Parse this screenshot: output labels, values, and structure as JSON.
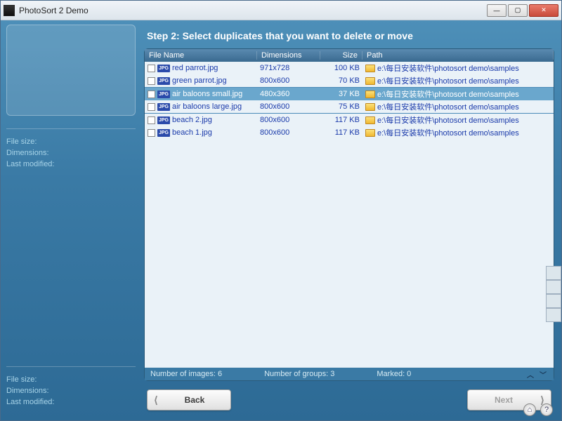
{
  "window": {
    "title": "PhotoSort 2 Demo"
  },
  "sidebar": {
    "info1": {
      "filesize": "File size:",
      "dimensions": "Dimensions:",
      "lastmod": "Last modified:"
    },
    "info2": {
      "filesize": "File size:",
      "dimensions": "Dimensions:",
      "lastmod": "Last modified:"
    }
  },
  "step_title": "Step 2:  Select duplicates that you want to delete or move",
  "columns": {
    "filename": "File Name",
    "dimensions": "Dimensions",
    "size": "Size",
    "path": "Path"
  },
  "rows": [
    {
      "name": "red parrot.jpg",
      "dim": "971x728",
      "size": "100 KB",
      "path": "e:\\每日安装软件\\photosort demo\\samples",
      "selected": false
    },
    {
      "name": "green parrot.jpg",
      "dim": "800x600",
      "size": "70 KB",
      "path": "e:\\每日安装软件\\photosort demo\\samples",
      "selected": false,
      "sep": true
    },
    {
      "name": "air baloons small.jpg",
      "dim": "480x360",
      "size": "37 KB",
      "path": "e:\\每日安装软件\\photosort demo\\samples",
      "selected": true
    },
    {
      "name": "air baloons large.jpg",
      "dim": "800x600",
      "size": "75 KB",
      "path": "e:\\每日安装软件\\photosort demo\\samples",
      "selected": false,
      "sep": true
    },
    {
      "name": "beach 2.jpg",
      "dim": "800x600",
      "size": "117 KB",
      "path": "e:\\每日安装软件\\photosort demo\\samples",
      "selected": false
    },
    {
      "name": "beach 1.jpg",
      "dim": "800x600",
      "size": "117 KB",
      "path": "e:\\每日安装软件\\photosort demo\\samples",
      "selected": false
    }
  ],
  "status": {
    "images": "Number of images: 6",
    "groups": "Number of groups: 3",
    "marked": "Marked: 0"
  },
  "nav": {
    "back": "Back",
    "next": "Next"
  },
  "jpg_label": "JPG"
}
